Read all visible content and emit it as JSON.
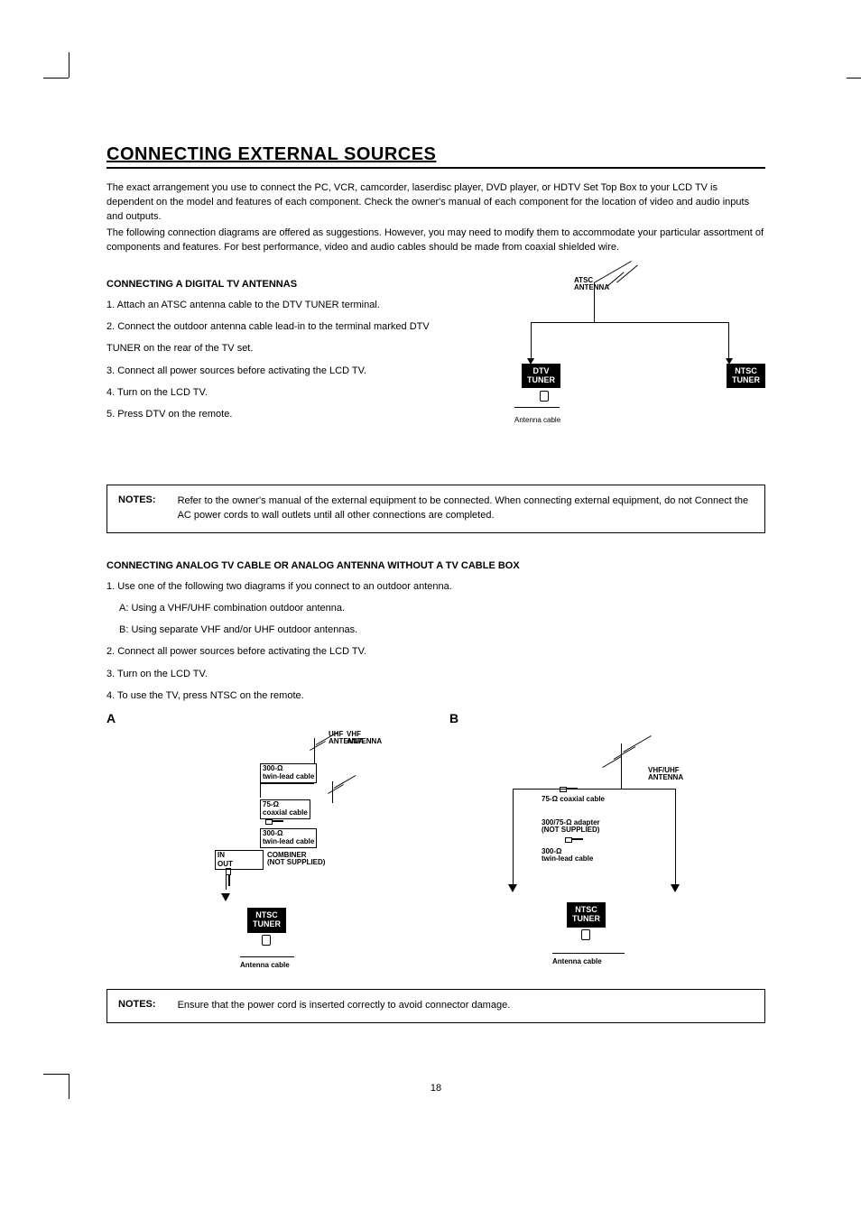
{
  "title": "CONNECTING EXTERNAL SOURCES",
  "intro": {
    "p1": "The exact arrangement you use to connect the PC, VCR, camcorder, laserdisc player, DVD player, or HDTV Set Top Box to your LCD TV is dependent on the model and features of each component. Check the owner's manual of each component for the location of video and audio inputs and outputs.",
    "p2": "The following connection diagrams are offered as suggestions. However, you may need to modify them to accommodate your particular assortment of components and features. For best performance, video and audio cables should be made from coaxial shielded wire."
  },
  "section1": {
    "heading": "CONNECTING A DIGITAL TV ANTENNAS",
    "s1": "1. Attach an ATSC antenna cable to the DTV TUNER terminal.",
    "s2": "2. Connect the outdoor antenna cable lead-in to the terminal marked DTV",
    "s2b": "TUNER on the rear of the TV set.",
    "s3": "3. Connect all power sources before activating the LCD TV.",
    "s4": "4. Turn on the LCD TV.",
    "s5": "5. Press DTV on the remote."
  },
  "diagram1": {
    "atsc": "ATSC\nANTENNA",
    "dtv": "DTV\nTUNER",
    "ntsc": "NTSC\nTUNER",
    "cable": "Antenna cable"
  },
  "notes": {
    "label": "NOTES:",
    "text1": "Refer to the owner's manual of the external equipment to be connected. When connecting external equipment, do not Connect the AC power cords to wall outlets until all other connections are completed."
  },
  "section2": {
    "heading": "CONNECTING ANALOG TV CABLE OR ANALOG ANTENNA WITHOUT A TV CABLE BOX",
    "s1": "1. Use one of the following two diagrams if you connect to an outdoor antenna.",
    "s1a": "A: Using a VHF/UHF combination outdoor antenna.",
    "s1b": "B: Using separate VHF and/or UHF outdoor antennas.",
    "s2": "2. Connect all power sources before activating the LCD TV.",
    "s3": "3. Turn on the LCD TV.",
    "s4": "4. To use the TV, press NTSC on the remote."
  },
  "letters": {
    "a": "A",
    "b": "B"
  },
  "diagA": {
    "uhf": "UHF\nANTENNA",
    "vhf": "VHF\nANTENNA",
    "twin1": "300-Ω\ntwin-lead cable",
    "coax": "75-Ω\ncoaxial cable",
    "twin2": "300-Ω\ntwin-lead cable",
    "in": "IN",
    "out": "OUT",
    "combiner": "COMBINER\n(NOT SUPPLIED)",
    "ntsc": "NTSC\nTUNER",
    "antenna_cable": "Antenna cable"
  },
  "diagB": {
    "vhfuhf": "VHF/UHF\nANTENNA",
    "coax": "75-Ω coaxial cable",
    "adapter": "300/75-Ω adapter\n(NOT SUPPLIED)",
    "twin": "300-Ω\ntwin-lead cable",
    "ntsc": "NTSC\nTUNER",
    "antenna_cable": "Antenna cable"
  },
  "notes2": {
    "label": "NOTES:",
    "text": "Ensure that the power cord is inserted correctly to avoid connector damage."
  },
  "page_number": "18"
}
